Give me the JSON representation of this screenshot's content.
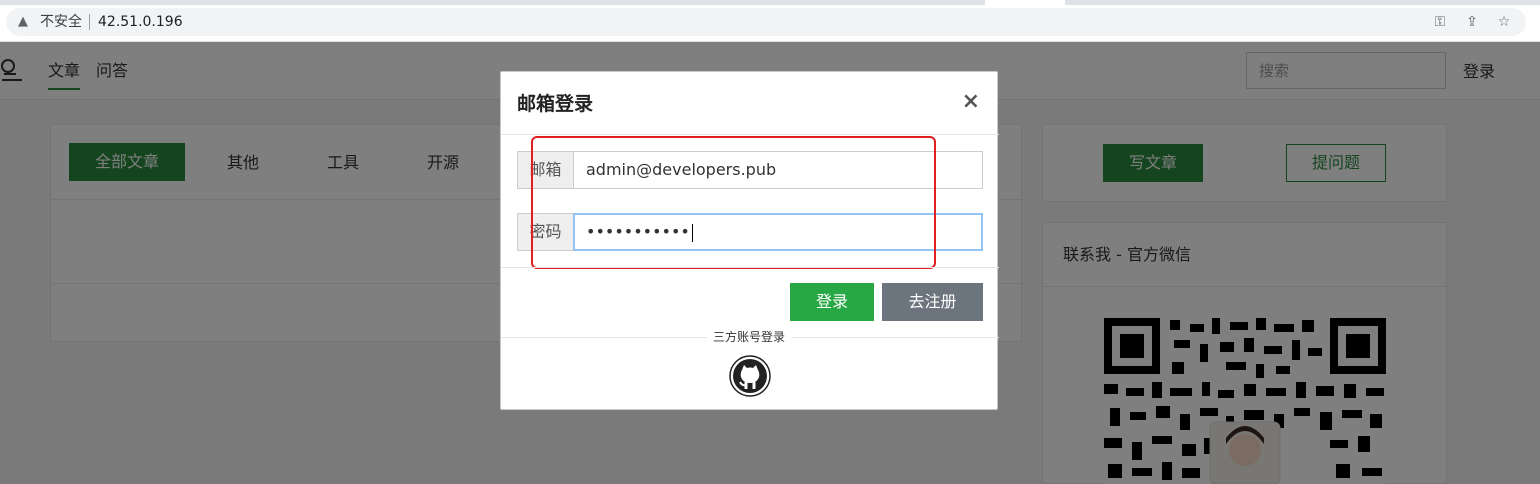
{
  "browser": {
    "security_label": "不安全",
    "url": "42.51.0.196"
  },
  "site": {
    "nav": {
      "articles": "文章",
      "qa": "问答",
      "search_placeholder": "搜索",
      "login": "登录"
    },
    "categories": [
      "全部文章",
      "其他",
      "工具",
      "开源"
    ],
    "sidebar": {
      "write_article": "写文章",
      "ask_question": "提问题",
      "contact_title": "联系我 - 官方微信"
    }
  },
  "modal": {
    "title": "邮箱登录",
    "close": "×",
    "email_label": "邮箱",
    "email_value": "admin@developers.pub",
    "password_label": "密码",
    "password_value": "•••••••••••",
    "login_button": "登录",
    "register_button": "去注册",
    "third_party_label": "三方账号登录"
  },
  "icons": {
    "warning": "warning-triangle-icon",
    "key": "key-icon",
    "share": "share-icon",
    "star": "star-icon",
    "github": "github-icon",
    "close": "close-icon"
  },
  "colors": {
    "accent": "#2a8a3e",
    "login_btn": "#28a745",
    "register_btn": "#6c757d",
    "highlight": "#e02020"
  }
}
